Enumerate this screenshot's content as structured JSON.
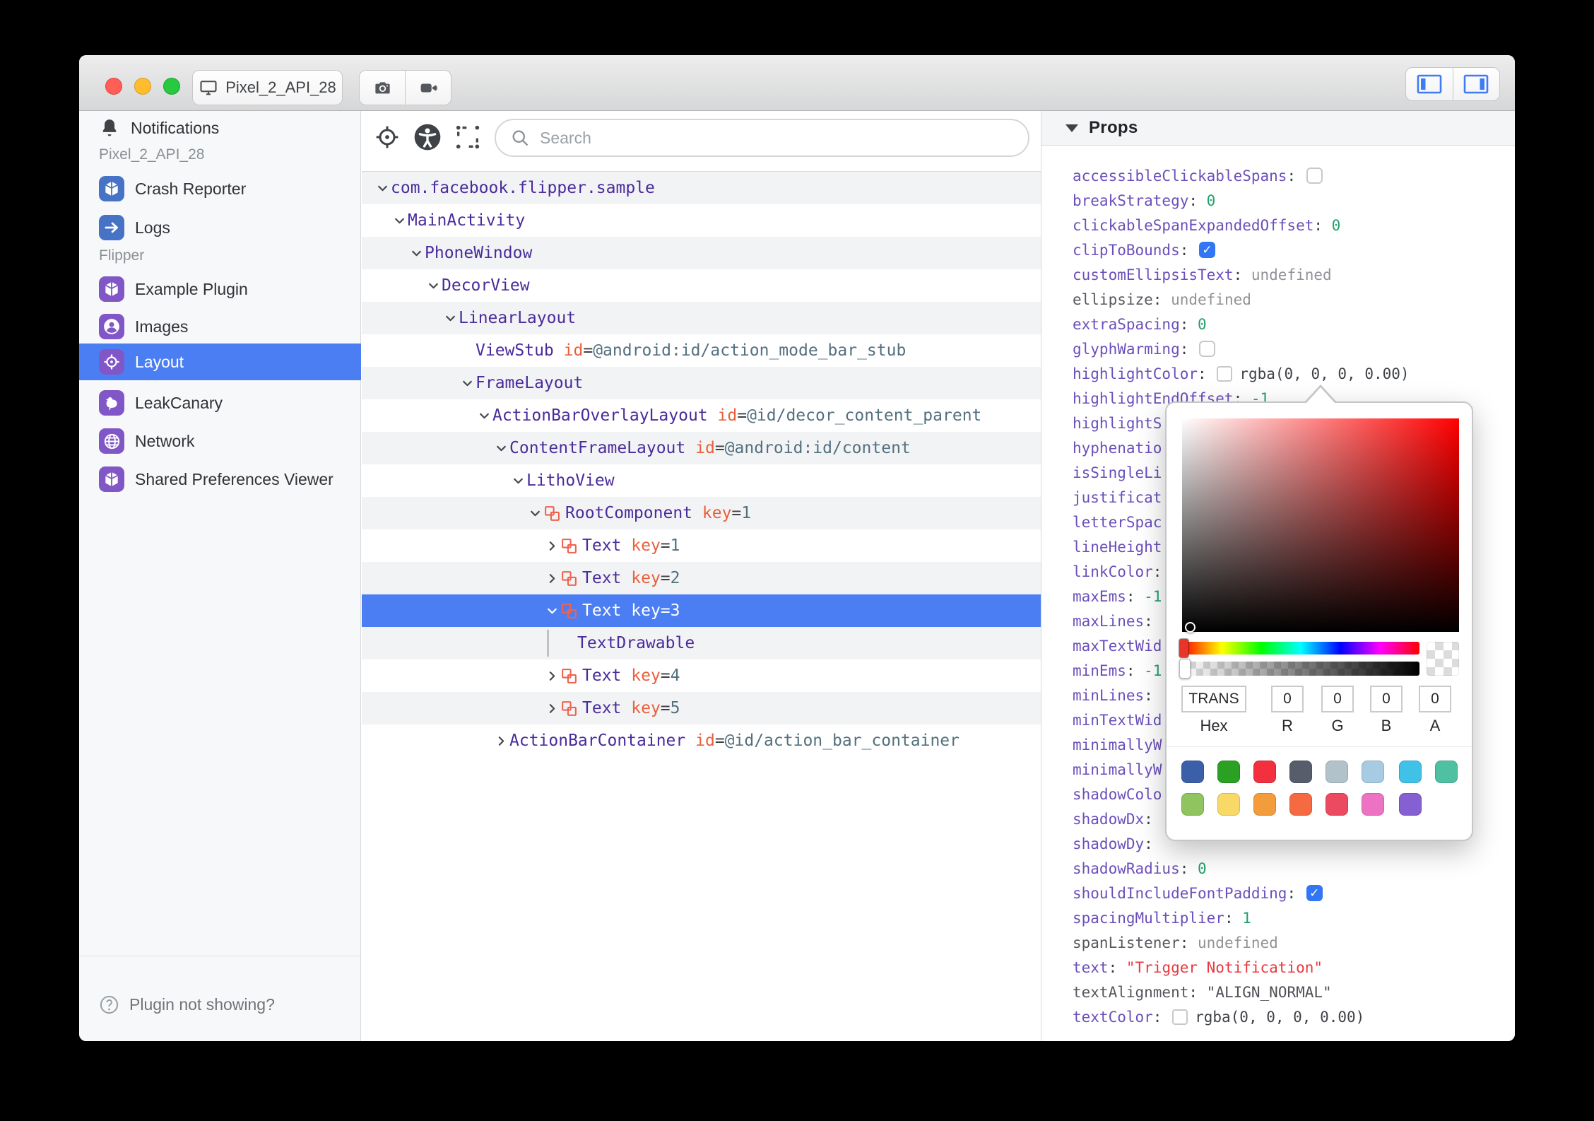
{
  "titlebar": {
    "device_name": "Pixel_2_API_28"
  },
  "sidebar": {
    "notifications_label": "Notifications",
    "sections": [
      {
        "label": "Pixel_2_API_28",
        "items": [
          {
            "icon": "cube",
            "label": "Crash Reporter",
            "color": "blue"
          },
          {
            "icon": "arrow-right",
            "label": "Logs",
            "color": "blue"
          }
        ]
      },
      {
        "label": "Flipper",
        "items": [
          {
            "icon": "cube",
            "label": "Example Plugin",
            "color": "purple"
          },
          {
            "icon": "user-circle",
            "label": "Images",
            "color": "purple"
          },
          {
            "icon": "target",
            "label": "Layout",
            "color": "purple",
            "selected": true
          },
          {
            "icon": "bird",
            "label": "LeakCanary",
            "color": "purple"
          },
          {
            "icon": "globe",
            "label": "Network",
            "color": "purple"
          },
          {
            "icon": "cube",
            "label": "Shared Preferences Viewer",
            "color": "purple"
          }
        ]
      }
    ],
    "footer_label": "Plugin not showing?"
  },
  "toolbar": {
    "search_placeholder": "Search"
  },
  "tree": {
    "nodes": [
      {
        "level": 0,
        "state": "open",
        "name": "com.facebook.flipper.sample"
      },
      {
        "level": 1,
        "state": "open",
        "name": "MainActivity"
      },
      {
        "level": 2,
        "state": "open",
        "name": "PhoneWindow"
      },
      {
        "level": 3,
        "state": "open",
        "name": "DecorView"
      },
      {
        "level": 4,
        "state": "open",
        "name": "LinearLayout"
      },
      {
        "level": 5,
        "state": "leaf",
        "name": "ViewStub",
        "attr_key": "id",
        "attr_value": "@android:id/action_mode_bar_stub"
      },
      {
        "level": 5,
        "state": "open",
        "name": "FrameLayout"
      },
      {
        "level": 6,
        "state": "open",
        "name": "ActionBarOverlayLayout",
        "attr_key": "id",
        "attr_value": "@id/decor_content_parent"
      },
      {
        "level": 7,
        "state": "open",
        "name": "ContentFrameLayout",
        "attr_key": "id",
        "attr_value": "@android:id/content"
      },
      {
        "level": 8,
        "state": "open",
        "name": "LithoView"
      },
      {
        "level": 9,
        "state": "open",
        "component": true,
        "name": "RootComponent",
        "attr_key": "key",
        "attr_value": "1"
      },
      {
        "level": 10,
        "state": "closed",
        "component": true,
        "name": "Text",
        "attr_key": "key",
        "attr_value": "1"
      },
      {
        "level": 10,
        "state": "closed",
        "component": true,
        "name": "Text",
        "attr_key": "key",
        "attr_value": "2"
      },
      {
        "level": 10,
        "state": "open",
        "component": true,
        "name": "Text",
        "attr_key": "key",
        "attr_value": "3",
        "selected": true
      },
      {
        "level": 11,
        "state": "leaf",
        "name": "TextDrawable",
        "guide_bar": true
      },
      {
        "level": 10,
        "state": "closed",
        "component": true,
        "name": "Text",
        "attr_key": "key",
        "attr_value": "4"
      },
      {
        "level": 10,
        "state": "closed",
        "component": true,
        "name": "Text",
        "attr_key": "key",
        "attr_value": "5"
      },
      {
        "level": 7,
        "state": "closed",
        "name": "ActionBarContainer",
        "attr_key": "id",
        "attr_value": "@id/action_bar_container"
      }
    ]
  },
  "props": {
    "title": "Props",
    "rows": [
      {
        "key": "accessibleClickableSpans",
        "type": "checkbox",
        "checked": false
      },
      {
        "key": "breakStrategy",
        "type": "number",
        "value": "0"
      },
      {
        "key": "clickableSpanExpandedOffset",
        "type": "number",
        "value": "0"
      },
      {
        "key": "clipToBounds",
        "type": "checkbox",
        "checked": true
      },
      {
        "key": "customEllipsisText",
        "type": "undefined",
        "value": "undefined"
      },
      {
        "key": "ellipsize",
        "type": "undefined",
        "value": "undefined",
        "muted": true
      },
      {
        "key": "extraSpacing",
        "type": "number",
        "value": "0"
      },
      {
        "key": "glyphWarming",
        "type": "checkbox",
        "checked": false
      },
      {
        "key": "highlightColor",
        "type": "color",
        "value": "rgba(0, 0, 0, 0.00)"
      },
      {
        "key": "highlightEndOffset",
        "type": "number",
        "value": "-1"
      },
      {
        "key": "highlightS",
        "type": "truncated"
      },
      {
        "key": "hyphenatio",
        "type": "truncated"
      },
      {
        "key": "isSingleLi",
        "type": "truncated"
      },
      {
        "key": "justificat",
        "type": "truncated"
      },
      {
        "key": "letterSpac",
        "type": "truncated"
      },
      {
        "key": "lineHeight",
        "type": "truncated"
      },
      {
        "key": "linkColor",
        "type": "hidden"
      },
      {
        "key": "maxEms",
        "type": "number",
        "value": "-1"
      },
      {
        "key": "maxLines",
        "type": "hidden"
      },
      {
        "key": "maxTextWid",
        "type": "truncated"
      },
      {
        "key": "minEms",
        "type": "number",
        "value": "-1"
      },
      {
        "key": "minLines",
        "type": "hidden"
      },
      {
        "key": "minTextWid",
        "type": "truncated"
      },
      {
        "key": "minimallyW",
        "type": "truncated"
      },
      {
        "key": "minimallyW",
        "type": "truncated"
      },
      {
        "key": "shadowColo",
        "type": "truncated"
      },
      {
        "key": "shadowDx",
        "type": "hidden"
      },
      {
        "key": "shadowDy",
        "type": "hidden"
      },
      {
        "key": "shadowRadius",
        "type": "number",
        "value": "0"
      },
      {
        "key": "shouldIncludeFontPadding",
        "type": "checkbox",
        "checked": true
      },
      {
        "key": "spacingMultiplier",
        "type": "number",
        "value": "1"
      },
      {
        "key": "spanListener",
        "type": "undefined",
        "value": "undefined",
        "muted": true
      },
      {
        "key": "text",
        "type": "string",
        "value": "Trigger Notification"
      },
      {
        "key": "textAlignment",
        "type": "enum",
        "value": "ALIGN_NORMAL",
        "muted": true
      },
      {
        "key": "textColor",
        "type": "color",
        "value": "rgba(0, 0, 0, 0.00)"
      }
    ]
  },
  "color_picker": {
    "hex_value": "TRANS",
    "r_value": "0",
    "g_value": "0",
    "b_value": "0",
    "a_value": "0",
    "hex_label": "Hex",
    "r_label": "R",
    "g_label": "G",
    "b_label": "B",
    "a_label": "A",
    "swatches_row1": [
      "#3c5fa9",
      "#2aa122",
      "#f2303e",
      "#575e6b",
      "#b1c2cb",
      "#a7cbe2",
      "#3fc1e8",
      "#50c0a2"
    ],
    "swatches_row2": [
      "#8fc45f",
      "#f8d968",
      "#f29c3b",
      "#f56a41",
      "#eb4a61",
      "#ee72c3",
      "#8560d2"
    ]
  },
  "colors": {
    "selection_blue": "#4c7ef3",
    "icon_blue": "#4673c5",
    "icon_purple": "#8157c8",
    "component_salmon": "#f0624d",
    "checkbox_blue": "#3076f5",
    "toggle_icon_blue": "#3e7bf7"
  }
}
